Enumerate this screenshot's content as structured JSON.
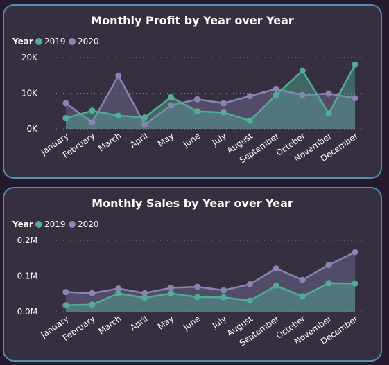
{
  "colors": {
    "y2019": "#4fae95",
    "y2020": "#8a84b4"
  },
  "chart_data": [
    {
      "type": "area",
      "title": "Monthly Profit by Year over Year",
      "legend_title": "Year",
      "legend_position": "top-left",
      "grid": true,
      "categories": [
        "January",
        "February",
        "March",
        "April",
        "May",
        "June",
        "July",
        "August",
        "September",
        "October",
        "November",
        "December"
      ],
      "yticks": [
        "0K",
        "10K",
        "20K"
      ],
      "ylim": [
        0,
        20000
      ],
      "series": [
        {
          "name": "2019",
          "values": [
            3000,
            5100,
            3700,
            3200,
            8900,
            4900,
            4600,
            2300,
            9500,
            16300,
            4300,
            18000
          ]
        },
        {
          "name": "2020",
          "values": [
            7200,
            1800,
            14900,
            1200,
            6600,
            8300,
            7200,
            9200,
            11200,
            9500,
            9900,
            8600
          ]
        }
      ]
    },
    {
      "type": "area",
      "title": "Monthly Sales by Year over Year",
      "legend_title": "Year",
      "legend_position": "top-left",
      "grid": true,
      "categories": [
        "January",
        "February",
        "March",
        "April",
        "May",
        "June",
        "July",
        "August",
        "September",
        "October",
        "November",
        "December"
      ],
      "yticks": [
        "0.0M",
        "0.1M",
        "0.2M"
      ],
      "ylim": [
        0,
        0.2
      ],
      "series": [
        {
          "name": "2019",
          "values": [
            0.018,
            0.02,
            0.051,
            0.039,
            0.051,
            0.041,
            0.04,
            0.031,
            0.073,
            0.043,
            0.08,
            0.079
          ]
        },
        {
          "name": "2020",
          "values": [
            0.055,
            0.052,
            0.065,
            0.052,
            0.067,
            0.07,
            0.06,
            0.077,
            0.121,
            0.089,
            0.131,
            0.167
          ]
        }
      ]
    }
  ]
}
